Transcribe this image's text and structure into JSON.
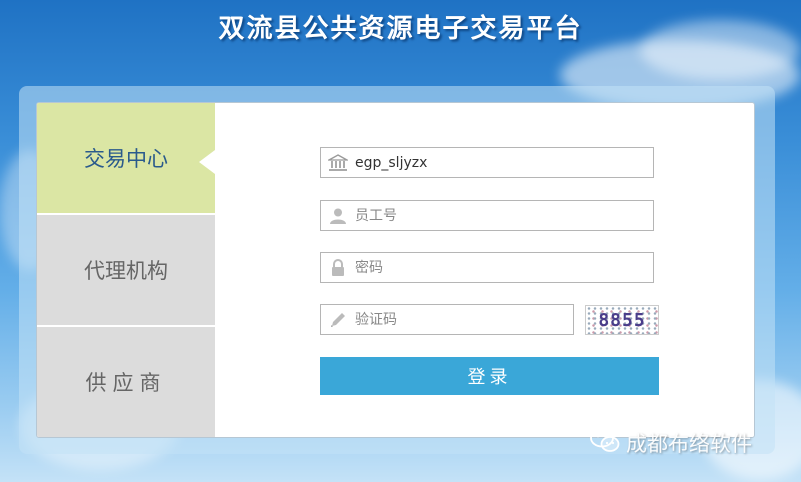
{
  "header": {
    "title": "双流县公共资源电子交易平台"
  },
  "tabs": [
    {
      "label": "交易中心",
      "active": true
    },
    {
      "label": "代理机构",
      "active": false
    },
    {
      "label": "供应商",
      "active": false
    }
  ],
  "form": {
    "username_value": "egp_sljyzx",
    "employee_placeholder": "员工号",
    "password_placeholder": "密码",
    "captcha_placeholder": "验证码",
    "captcha_text": "8855",
    "login_label": "登录"
  },
  "watermark": {
    "text": "成都布络软件"
  },
  "colors": {
    "accent": "#3aa7d8",
    "active_tab": "#dbe6a4",
    "inactive_tab": "#dcdcdc"
  },
  "icons": [
    "bank-icon",
    "user-icon",
    "lock-icon",
    "pencil-icon",
    "wechat-icon"
  ]
}
